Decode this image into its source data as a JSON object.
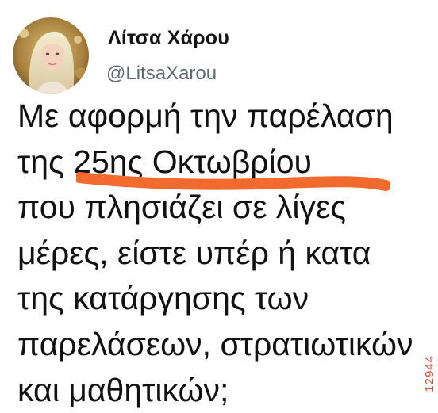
{
  "tweet": {
    "display_name": "Λίτσα Χάρου",
    "handle": "@LitsaXarou",
    "lines": [
      "Με αφορμή την παρέλαση",
      "της 25ης Οκτωβρίου",
      "που πλησιάζει σε λίγες",
      "μέρες, είστε υπέρ ή κατα",
      "της κατάργησης των",
      "παρελάσεων, στρατιωτικών",
      "και μαθητικών;"
    ]
  },
  "annotation": {
    "underline_color": "#f26a2e"
  },
  "watermark": {
    "text": "12944"
  },
  "icons": {
    "avatar": "profile-photo-avatar"
  }
}
